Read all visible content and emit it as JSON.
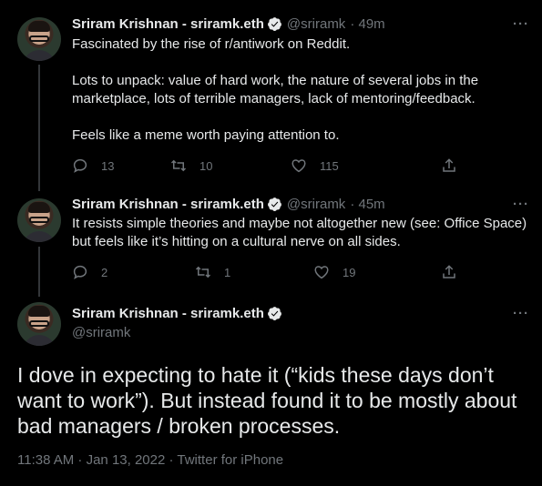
{
  "tweets": [
    {
      "name": "Sriram Krishnan - sriramk.eth",
      "handle": "@sriramk",
      "time": "· 49m",
      "text": "Fascinated by the rise of r/antiwork on Reddit.\n\nLots to unpack: value of hard work, the nature of several jobs in the marketplace, lots of terrible managers, lack of mentoring/feedback.\n\nFeels like a meme worth paying attention to.",
      "replies": "13",
      "retweets": "10",
      "likes": "115"
    },
    {
      "name": "Sriram Krishnan - sriramk.eth",
      "handle": "@sriramk",
      "time": "· 45m",
      "text": "It resists simple theories and maybe not altogether new (see: Office Space) but feels like it’s hitting on a cultural nerve on all sides.",
      "replies": "2",
      "retweets": "1",
      "likes": "19"
    }
  ],
  "main_tweet": {
    "name": "Sriram Krishnan - sriramk.eth",
    "handle": "@sriramk",
    "text": "I dove in expecting to hate it (“kids these days don’t want to work”). But instead found it to be mostly about bad managers / broken processes.",
    "timestamp": "11:38 AM · Jan 13, 2022 · Twitter for iPhone"
  },
  "more_glyph": "···",
  "colors": {
    "background": "#000000",
    "text": "#e7e9ea",
    "muted": "#71767b",
    "verified": "#1d9bf0"
  },
  "icons": [
    "reply-icon",
    "retweet-icon",
    "like-icon",
    "share-icon",
    "verified-badge-icon",
    "more-icon"
  ]
}
